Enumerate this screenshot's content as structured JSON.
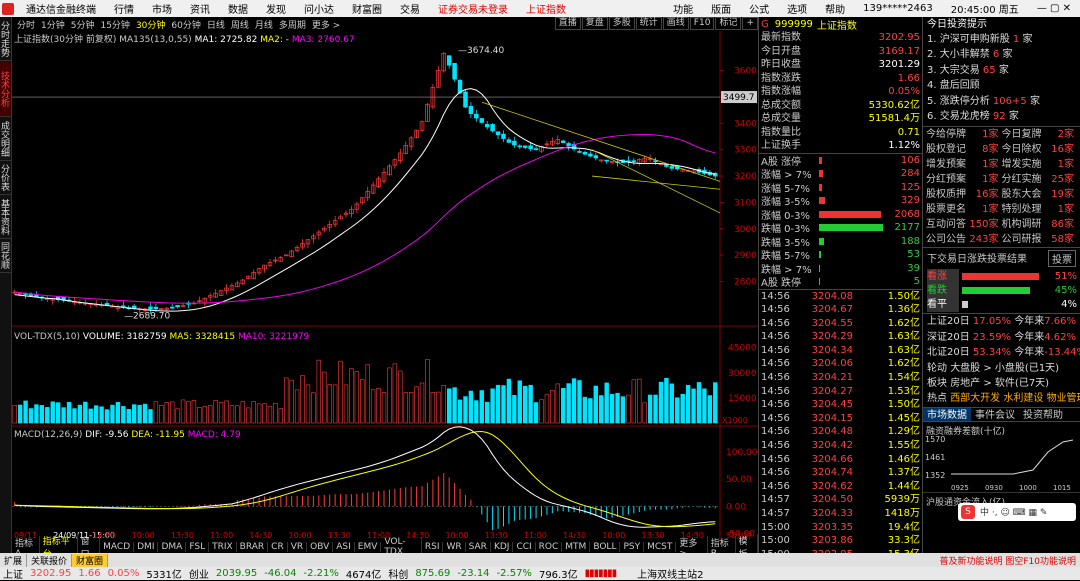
{
  "menubar": {
    "app": "通达信金融终端",
    "items": [
      "行情",
      "市场",
      "资讯",
      "数据",
      "发现",
      "问小达",
      "财富圈",
      "交易"
    ],
    "notice": "证券交易未登录",
    "notice2": "上证指数",
    "right": [
      "功能",
      "版面",
      "公式",
      "选项",
      "帮助"
    ],
    "user": "139*****2463",
    "time": "20:45:00 周五"
  },
  "tabs": [
    "分时",
    "1分钟",
    "5分钟",
    "15分钟",
    "30分钟",
    "60分钟",
    "日线",
    "周线",
    "月线",
    "多周期",
    "更多 >"
  ],
  "active_tab": "30分钟",
  "tabs_right": [
    "直播",
    "复盘",
    "多股",
    "统计",
    "画线",
    "F10",
    "标记",
    "+"
  ],
  "leftbar": [
    "分时走势",
    "技术分析",
    "成交明细",
    "分价表",
    "基本资料",
    "同花顺"
  ],
  "chart_legend": {
    "title": "上证指数(30分钟 前复权)",
    "ma": "MA135(13,0,55)",
    "ma1": "MA1: 2725.82",
    "ma2": "MA2: -",
    "ma3": "MA3: 2760.67"
  },
  "vol_legend": {
    "title": "VOL-TDX(5,10)",
    "vol": "VOLUME: 3182759",
    "ma5": "MA5: 3328415",
    "ma10": "MA10: 3221979"
  },
  "macd_legend": {
    "title": "MACD(12,26,9)",
    "dif": "DIF: -9.56",
    "dea": "DEA: -11.95",
    "macd": "MACD: 4.79"
  },
  "price_axis": [
    "3600",
    "3500",
    "3400",
    "3300",
    "3200",
    "3100",
    "3000",
    "2900",
    "2800"
  ],
  "vol_axis": [
    "45000",
    "30000",
    "15000",
    "X1000"
  ],
  "macd_axis": [
    "100.00",
    "50.00",
    "0.00",
    "-50.00"
  ],
  "marker_high": "3674.40",
  "marker_low": "2689.70",
  "marker_current": "3499.7",
  "time_axis": [
    "09/11",
    "24/09/11-15:00",
    "14:30",
    "10:00",
    "13:30",
    "11:00",
    "14:30",
    "10:00",
    "13:30",
    "11:00",
    "14:30",
    "10:00",
    "13:30",
    "11:00",
    "14:30",
    "10:00",
    "13:30",
    "14:30",
    "30分钟"
  ],
  "bottom_tabs": [
    "指标A",
    "指标平台",
    "窗口",
    "MACD",
    "DMI",
    "DMA",
    "FSL",
    "TRIX",
    "BRAR",
    "CR",
    "VR",
    "OBV",
    "ASI",
    "EMV",
    "VOL-TDX",
    "RSI",
    "WR",
    "SAR",
    "KDJ",
    "CCI",
    "ROC",
    "MTM",
    "BOLL",
    "PSY",
    "MCST",
    "更多 >",
    "指标B",
    "模板"
  ],
  "subtabs": [
    "扩展",
    "关联报价",
    "财富圈"
  ],
  "quote": {
    "code": "G",
    "id": "999999",
    "name": "上证指数",
    "rows": [
      [
        "最新指数",
        "3202.95",
        "red"
      ],
      [
        "今日开盘",
        "3169.17",
        "red"
      ],
      [
        "昨日收盘",
        "3201.29",
        "wht"
      ],
      [
        "指数涨跌",
        "1.66",
        "red"
      ],
      [
        "指数涨幅",
        "0.05%",
        "red"
      ],
      [
        "总成交额",
        "5330.62亿",
        "yel"
      ],
      [
        "总成交量",
        "51581.4万",
        "yel"
      ],
      [
        "指数量比",
        "0.71",
        "yel"
      ],
      [
        "上证换手",
        "1.12%",
        "wht"
      ]
    ],
    "bars": [
      [
        "A股 涨停",
        "106",
        "red",
        3
      ],
      [
        "涨幅 > 7%",
        "284",
        "red",
        4
      ],
      [
        "涨幅 5-7%",
        "125",
        "red",
        3
      ],
      [
        "涨幅 3-5%",
        "329",
        "red",
        6
      ],
      [
        "涨幅 0-3%",
        "2068",
        "red",
        62
      ],
      [
        "跌幅 0-3%",
        "2177",
        "grn",
        64
      ],
      [
        "跌幅 3-5%",
        "188",
        "grn",
        5
      ],
      [
        "跌幅 5-7%",
        "53",
        "grn",
        2
      ],
      [
        "跌幅 > 7%",
        "39",
        "grn",
        1
      ],
      [
        "A股 跌停",
        "5",
        "grn",
        1
      ]
    ],
    "ticks": [
      [
        "14:56",
        "3204.08",
        "1.50亿"
      ],
      [
        "14:56",
        "3204.67",
        "1.36亿"
      ],
      [
        "14:56",
        "3204.55",
        "1.62亿"
      ],
      [
        "14:56",
        "3204.29",
        "1.63亿"
      ],
      [
        "14:56",
        "3204.34",
        "1.63亿"
      ],
      [
        "14:56",
        "3204.06",
        "1.62亿"
      ],
      [
        "14:56",
        "3204.21",
        "1.54亿"
      ],
      [
        "14:56",
        "3204.27",
        "1.53亿"
      ],
      [
        "14:56",
        "3204.45",
        "1.50亿"
      ],
      [
        "14:56",
        "3204.15",
        "1.45亿"
      ],
      [
        "14:56",
        "3204.48",
        "1.29亿"
      ],
      [
        "14:56",
        "3204.42",
        "1.55亿"
      ],
      [
        "14:56",
        "3204.66",
        "1.46亿"
      ],
      [
        "14:56",
        "3204.74",
        "1.37亿"
      ],
      [
        "14:56",
        "3204.62",
        "1.44亿"
      ],
      [
        "14:57",
        "3204.50",
        "5939万"
      ],
      [
        "14:57",
        "3204.33",
        "1418万"
      ],
      [
        "15:00",
        "3203.35",
        "19.4亿"
      ],
      [
        "15:00",
        "3203.86",
        "33.3亿"
      ],
      [
        "15:00",
        "3202.95",
        "15.3亿"
      ]
    ]
  },
  "info": {
    "title": "今日投资提示",
    "items": [
      [
        "1. 沪深可申购新股",
        "1",
        "家"
      ],
      [
        "2. 大小非解禁",
        "6",
        "家"
      ],
      [
        "3. 大宗交易",
        "65",
        "家"
      ],
      [
        "4. 盘后回顾",
        "",
        ""
      ],
      [
        "5. 涨跌停分析",
        "106+5",
        "家"
      ],
      [
        "6. 交易龙虎榜",
        "92",
        "家"
      ]
    ],
    "grid": [
      [
        "今给停牌",
        "1家",
        "今日复牌",
        "2家"
      ],
      [
        "股权登记",
        "8家",
        "今日除权",
        "16家"
      ],
      [
        "增发预案",
        "1家",
        "增发实施",
        "1家"
      ],
      [
        "分红预案",
        "1家",
        "分红实施",
        "25家"
      ],
      [
        "股权质押",
        "16家",
        "股东大会",
        "19家"
      ],
      [
        "股票更名",
        "1家",
        "特别处理",
        "1家"
      ],
      [
        "互动问答",
        "150家",
        "机构调研",
        "86家"
      ],
      [
        "公司公告",
        "243家",
        "公司研报",
        "58家"
      ]
    ],
    "vote_title": "下交易日涨跌投票结果",
    "vote_btn": "投票",
    "votes": [
      [
        "看涨",
        "51%",
        "red",
        51
      ],
      [
        "看跌",
        "45%",
        "grn",
        45
      ],
      [
        "看平",
        "4%",
        "wht",
        4
      ]
    ],
    "perf": [
      [
        "上证20日",
        "17.05%",
        "今年来",
        "7.66%"
      ],
      [
        "深证20日",
        "23.59%",
        "今年来",
        "4.62%"
      ],
      [
        "北证20日",
        "53.34%",
        "今年来",
        "-13.44%"
      ]
    ],
    "rotate": [
      "轮动",
      "大盘股 > 小盘股(已1天)"
    ],
    "sector": [
      "板块",
      "房地产 > 软件(已7天)"
    ],
    "hot": [
      "热点",
      "西部大开发",
      "水利建设",
      "物业管理"
    ],
    "tabs": [
      "市场数据",
      "事件会议",
      "投资帮助"
    ],
    "mini1": "融资融券差额(十亿)",
    "mini1_axis": [
      "1570",
      "1461",
      "1352"
    ],
    "mini1_x": [
      "0925",
      "0930",
      "1000",
      "1015"
    ],
    "mini2": "沪股通资金流入(亿)"
  },
  "status": [
    "上证",
    "3202.95",
    "1.66",
    "0.05%",
    "5331亿",
    "创业",
    "2039.95",
    "-46.04",
    "-2.21%",
    "4674亿",
    "科创",
    "875.69",
    "-23.14",
    "-2.57%",
    "796.3亿"
  ],
  "status_right": "上海双线主站2",
  "status_notice": "普及新功能说明 图空F10功能说明"
}
